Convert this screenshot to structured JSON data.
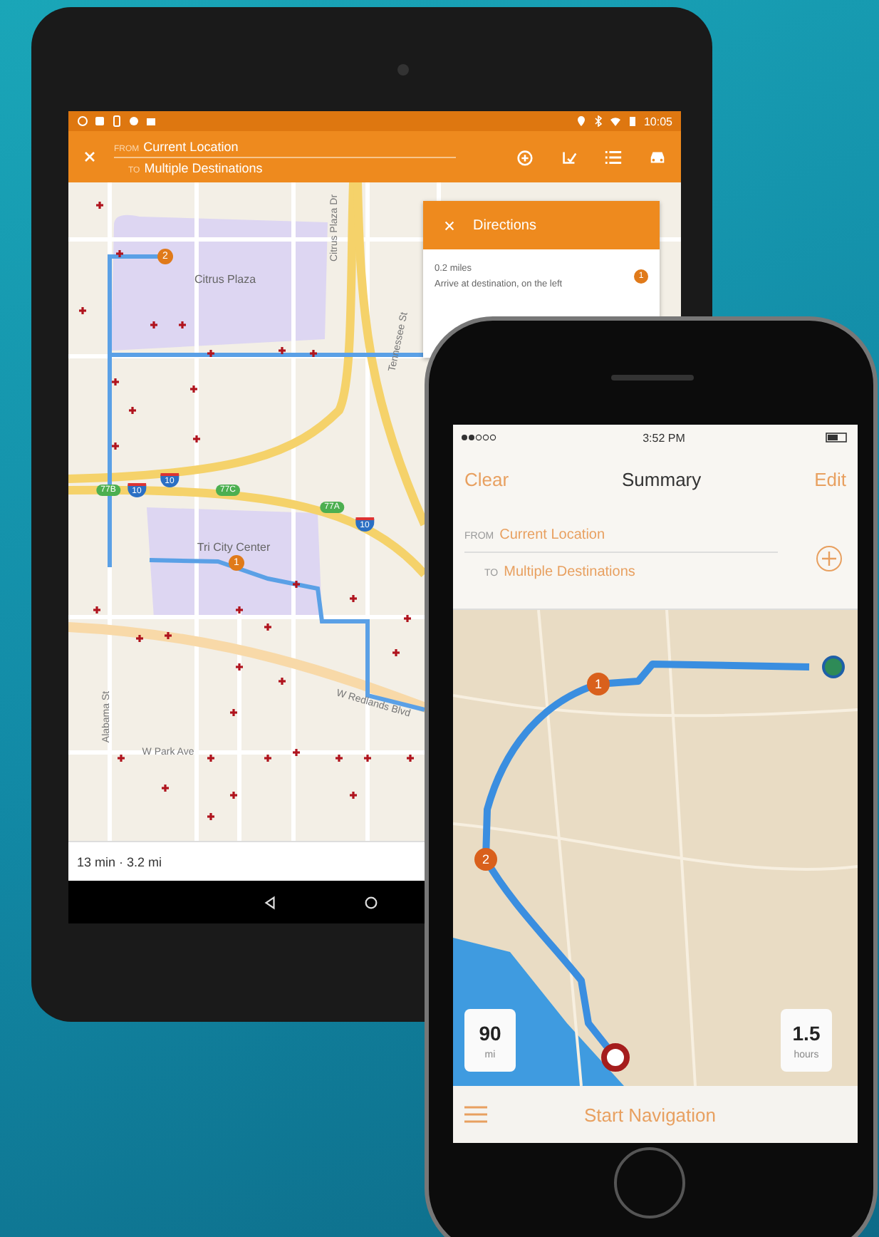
{
  "tablet": {
    "status_bar": {
      "time": "10:05"
    },
    "header": {
      "from_label": "FROM",
      "from": "Current Location",
      "to_label": "TO",
      "to": "Multiple Destinations"
    },
    "map": {
      "labels": [
        {
          "text": "Citrus Plaza",
          "kind": "place"
        },
        {
          "text": "Citrus Plaza Dr",
          "kind": "street"
        },
        {
          "text": "Tennessee St",
          "kind": "street"
        },
        {
          "text": "Tri City Center",
          "kind": "place"
        },
        {
          "text": "Alabama St",
          "kind": "street"
        },
        {
          "text": "W Redlands Blvd",
          "kind": "street"
        },
        {
          "text": "W Park Ave",
          "kind": "street"
        }
      ],
      "shields": [
        {
          "text": "77B",
          "kind": "exit"
        },
        {
          "text": "10",
          "kind": "interstate"
        },
        {
          "text": "10",
          "kind": "interstate"
        },
        {
          "text": "77C",
          "kind": "exit"
        },
        {
          "text": "77A",
          "kind": "exit"
        },
        {
          "text": "10",
          "kind": "interstate"
        }
      ],
      "markers": [
        "2",
        "1"
      ]
    },
    "directions": {
      "title": "Directions",
      "steps": [
        {
          "distance": "0.2 miles",
          "instruction": "Arrive at destination, on the left",
          "marker": "1"
        }
      ]
    },
    "summary": "13 min · 3.2 mi"
  },
  "phone": {
    "status_bar": {
      "time": "3:52 PM"
    },
    "nav": {
      "left": "Clear",
      "title": "Summary",
      "right": "Edit"
    },
    "route": {
      "from_label": "FROM",
      "from": "Current Location",
      "to_label": "TO",
      "to": "Multiple Destinations"
    },
    "map": {
      "markers": [
        "1",
        "2"
      ]
    },
    "stats": [
      {
        "value": "90",
        "unit": "mi"
      },
      {
        "value": "1.5",
        "unit": "hours"
      }
    ],
    "action": "Start Navigation"
  }
}
